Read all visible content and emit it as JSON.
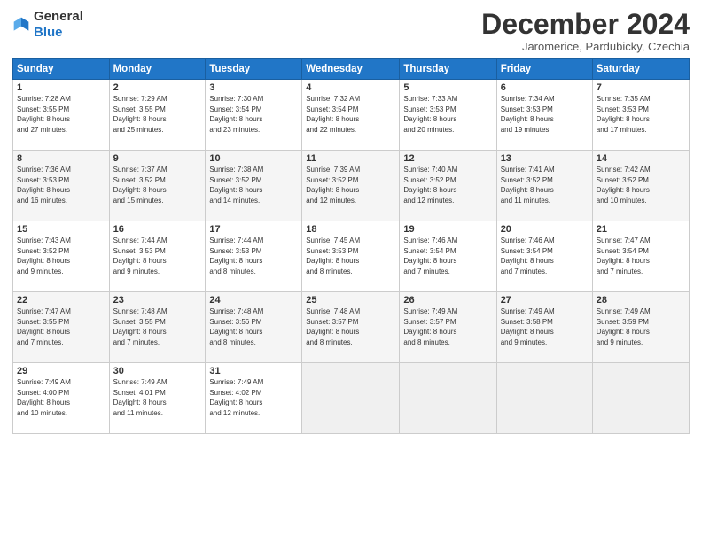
{
  "header": {
    "logo_general": "General",
    "logo_blue": "Blue",
    "month_title": "December 2024",
    "location": "Jaromerice, Pardubicky, Czechia"
  },
  "days_of_week": [
    "Sunday",
    "Monday",
    "Tuesday",
    "Wednesday",
    "Thursday",
    "Friday",
    "Saturday"
  ],
  "weeks": [
    [
      {
        "day": 1,
        "info": "Sunrise: 7:28 AM\nSunset: 3:55 PM\nDaylight: 8 hours\nand 27 minutes."
      },
      {
        "day": 2,
        "info": "Sunrise: 7:29 AM\nSunset: 3:55 PM\nDaylight: 8 hours\nand 25 minutes."
      },
      {
        "day": 3,
        "info": "Sunrise: 7:30 AM\nSunset: 3:54 PM\nDaylight: 8 hours\nand 23 minutes."
      },
      {
        "day": 4,
        "info": "Sunrise: 7:32 AM\nSunset: 3:54 PM\nDaylight: 8 hours\nand 22 minutes."
      },
      {
        "day": 5,
        "info": "Sunrise: 7:33 AM\nSunset: 3:53 PM\nDaylight: 8 hours\nand 20 minutes."
      },
      {
        "day": 6,
        "info": "Sunrise: 7:34 AM\nSunset: 3:53 PM\nDaylight: 8 hours\nand 19 minutes."
      },
      {
        "day": 7,
        "info": "Sunrise: 7:35 AM\nSunset: 3:53 PM\nDaylight: 8 hours\nand 17 minutes."
      }
    ],
    [
      {
        "day": 8,
        "info": "Sunrise: 7:36 AM\nSunset: 3:53 PM\nDaylight: 8 hours\nand 16 minutes."
      },
      {
        "day": 9,
        "info": "Sunrise: 7:37 AM\nSunset: 3:52 PM\nDaylight: 8 hours\nand 15 minutes."
      },
      {
        "day": 10,
        "info": "Sunrise: 7:38 AM\nSunset: 3:52 PM\nDaylight: 8 hours\nand 14 minutes."
      },
      {
        "day": 11,
        "info": "Sunrise: 7:39 AM\nSunset: 3:52 PM\nDaylight: 8 hours\nand 12 minutes."
      },
      {
        "day": 12,
        "info": "Sunrise: 7:40 AM\nSunset: 3:52 PM\nDaylight: 8 hours\nand 12 minutes."
      },
      {
        "day": 13,
        "info": "Sunrise: 7:41 AM\nSunset: 3:52 PM\nDaylight: 8 hours\nand 11 minutes."
      },
      {
        "day": 14,
        "info": "Sunrise: 7:42 AM\nSunset: 3:52 PM\nDaylight: 8 hours\nand 10 minutes."
      }
    ],
    [
      {
        "day": 15,
        "info": "Sunrise: 7:43 AM\nSunset: 3:52 PM\nDaylight: 8 hours\nand 9 minutes."
      },
      {
        "day": 16,
        "info": "Sunrise: 7:44 AM\nSunset: 3:53 PM\nDaylight: 8 hours\nand 9 minutes."
      },
      {
        "day": 17,
        "info": "Sunrise: 7:44 AM\nSunset: 3:53 PM\nDaylight: 8 hours\nand 8 minutes."
      },
      {
        "day": 18,
        "info": "Sunrise: 7:45 AM\nSunset: 3:53 PM\nDaylight: 8 hours\nand 8 minutes."
      },
      {
        "day": 19,
        "info": "Sunrise: 7:46 AM\nSunset: 3:54 PM\nDaylight: 8 hours\nand 7 minutes."
      },
      {
        "day": 20,
        "info": "Sunrise: 7:46 AM\nSunset: 3:54 PM\nDaylight: 8 hours\nand 7 minutes."
      },
      {
        "day": 21,
        "info": "Sunrise: 7:47 AM\nSunset: 3:54 PM\nDaylight: 8 hours\nand 7 minutes."
      }
    ],
    [
      {
        "day": 22,
        "info": "Sunrise: 7:47 AM\nSunset: 3:55 PM\nDaylight: 8 hours\nand 7 minutes."
      },
      {
        "day": 23,
        "info": "Sunrise: 7:48 AM\nSunset: 3:55 PM\nDaylight: 8 hours\nand 7 minutes."
      },
      {
        "day": 24,
        "info": "Sunrise: 7:48 AM\nSunset: 3:56 PM\nDaylight: 8 hours\nand 8 minutes."
      },
      {
        "day": 25,
        "info": "Sunrise: 7:48 AM\nSunset: 3:57 PM\nDaylight: 8 hours\nand 8 minutes."
      },
      {
        "day": 26,
        "info": "Sunrise: 7:49 AM\nSunset: 3:57 PM\nDaylight: 8 hours\nand 8 minutes."
      },
      {
        "day": 27,
        "info": "Sunrise: 7:49 AM\nSunset: 3:58 PM\nDaylight: 8 hours\nand 9 minutes."
      },
      {
        "day": 28,
        "info": "Sunrise: 7:49 AM\nSunset: 3:59 PM\nDaylight: 8 hours\nand 9 minutes."
      }
    ],
    [
      {
        "day": 29,
        "info": "Sunrise: 7:49 AM\nSunset: 4:00 PM\nDaylight: 8 hours\nand 10 minutes."
      },
      {
        "day": 30,
        "info": "Sunrise: 7:49 AM\nSunset: 4:01 PM\nDaylight: 8 hours\nand 11 minutes."
      },
      {
        "day": 31,
        "info": "Sunrise: 7:49 AM\nSunset: 4:02 PM\nDaylight: 8 hours\nand 12 minutes."
      },
      {
        "day": null,
        "info": ""
      },
      {
        "day": null,
        "info": ""
      },
      {
        "day": null,
        "info": ""
      },
      {
        "day": null,
        "info": ""
      }
    ]
  ]
}
